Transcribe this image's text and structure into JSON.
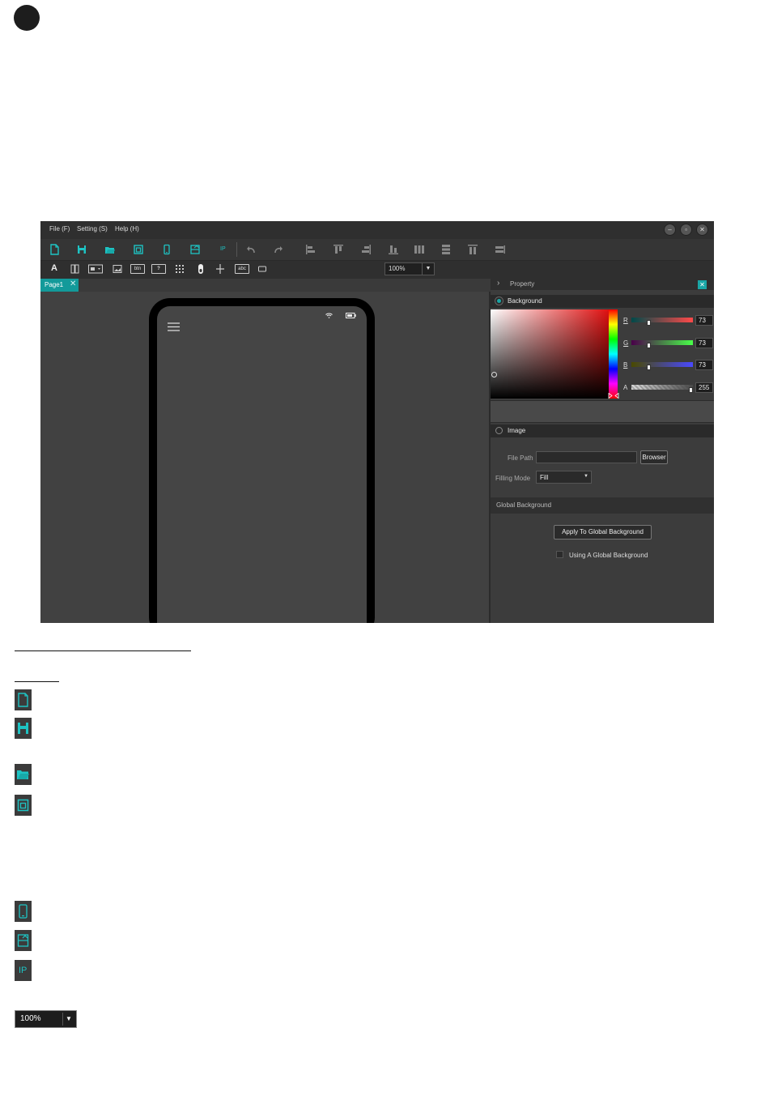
{
  "menu": {
    "file": "File (F)",
    "setting": "Setting (S)",
    "help": "Help (H)"
  },
  "window_controls": [
    "minimize-icon",
    "maximize-icon",
    "close-icon"
  ],
  "toolbar": {
    "file_icons": [
      "new-file-icon",
      "save-icon",
      "open-folder-icon",
      "window-icon",
      "phone-icon",
      "export-icon"
    ],
    "ip_label": "IP",
    "edit_icons": [
      "undo-icon",
      "redo-icon"
    ],
    "align_icons": [
      "align-left-icon",
      "align-top-icon",
      "align-right-icon",
      "align-bottom-icon",
      "distribute-vertical-icon",
      "distribute-horizontal-icon",
      "same-width-icon",
      "same-height-icon"
    ]
  },
  "controls": {
    "text_label": "A",
    "button_label": "btn",
    "help_label": "?",
    "textbox_label": "abc"
  },
  "zoom": {
    "value": "100%"
  },
  "tabs": [
    {
      "label": "Page1"
    }
  ],
  "property": {
    "title": "Property",
    "background_label": "Background",
    "channels": [
      {
        "label": "R",
        "value": "73"
      },
      {
        "label": "G",
        "value": "73"
      },
      {
        "label": "B",
        "value": "73"
      },
      {
        "label": "A",
        "value": "255"
      }
    ],
    "image_label": "Image",
    "file_path_label": "File Path",
    "file_path_value": "",
    "browser_label": "Browser",
    "filling_mode_label": "Filling Mode",
    "filling_mode_value": "Fill",
    "global_background_label": "Global Background",
    "apply_global_label": "Apply To Global Background",
    "using_global_label": "Using A Global Background"
  },
  "colors": {
    "accent": "#1aa6a6",
    "background": "#494949"
  },
  "doc": {
    "icons": [
      "new-file-icon",
      "save-icon",
      "open-folder-icon",
      "window-icon",
      "phone-icon",
      "export-icon"
    ],
    "ip_label": "IP",
    "zoom_value": "100%"
  }
}
